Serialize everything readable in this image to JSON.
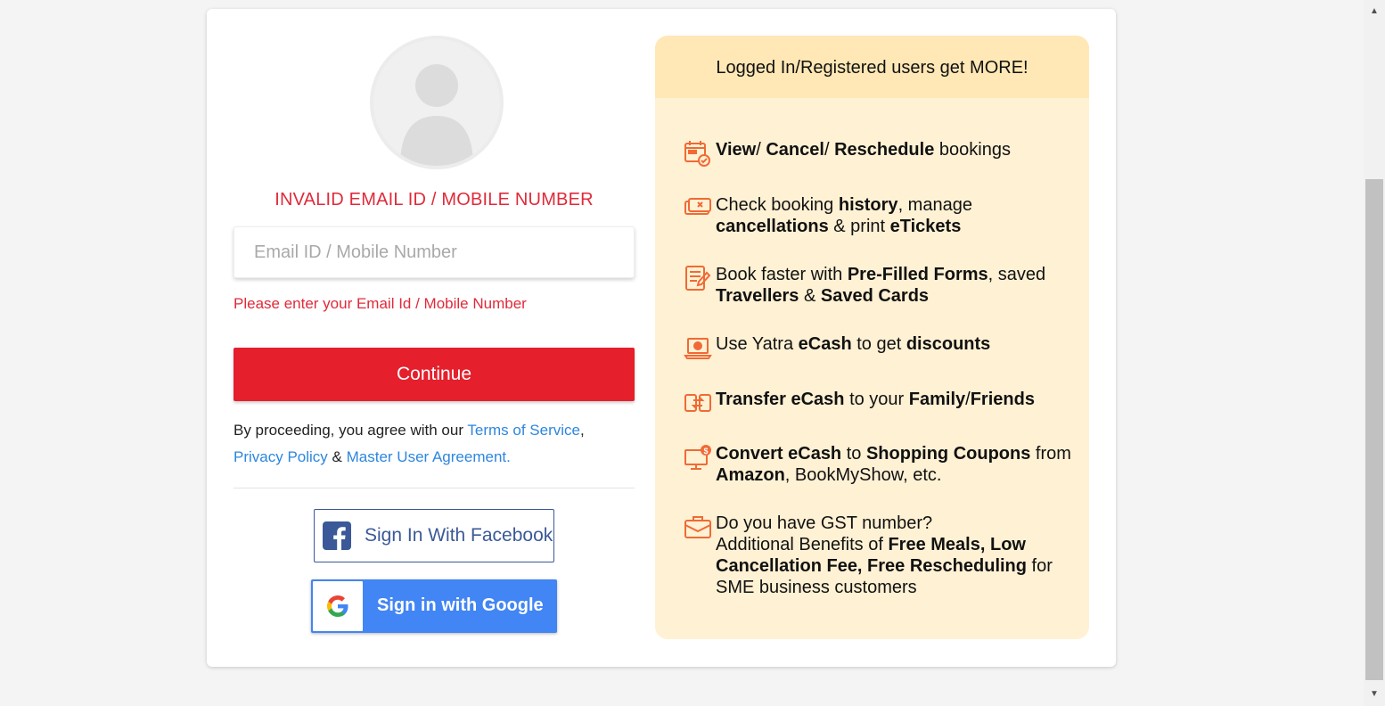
{
  "login": {
    "error_title": "INVALID EMAIL ID / MOBILE NUMBER",
    "email_placeholder": "Email ID / Mobile Number",
    "email_value": "",
    "error_help": "Please enter your Email Id / Mobile Number",
    "continue_label": "Continue",
    "terms": {
      "prefix": "By proceeding, you agree with our ",
      "tos": "Terms of Service",
      "comma": ",",
      "privacy": "Privacy Policy",
      "amp": " & ",
      "agreement": "Master User Agreement."
    },
    "facebook_label": "Sign In With Facebook",
    "google_label": "Sign in with Google"
  },
  "perks": {
    "header": "Logged In/Registered users get MORE!",
    "items": [
      {
        "icon": "calendar-check-icon",
        "parts": [
          [
            "View",
            true
          ],
          [
            "/ ",
            false
          ],
          [
            "Cancel",
            true
          ],
          [
            "/ ",
            false
          ],
          [
            "Reschedule",
            true
          ],
          [
            " bookings",
            false
          ]
        ]
      },
      {
        "icon": "ticket-cancel-icon",
        "parts": [
          [
            "Check booking ",
            false
          ],
          [
            "history",
            true
          ],
          [
            ", manage ",
            false
          ],
          [
            "cancellations",
            true
          ],
          [
            " & print ",
            false
          ],
          [
            "eTickets",
            true
          ]
        ]
      },
      {
        "icon": "form-icon",
        "parts": [
          [
            "Book faster with ",
            false
          ],
          [
            "Pre-Filled Forms",
            true
          ],
          [
            ", saved ",
            false
          ],
          [
            "Travellers",
            true
          ],
          [
            " & ",
            false
          ],
          [
            "Saved Cards",
            true
          ]
        ]
      },
      {
        "icon": "laptop-ecash-icon",
        "parts": [
          [
            "Use Yatra ",
            false
          ],
          [
            "eCash",
            true
          ],
          [
            " to get ",
            false
          ],
          [
            "discounts",
            true
          ]
        ]
      },
      {
        "icon": "transfer-ecash-icon",
        "parts": [
          [
            "Transfer eCash",
            true
          ],
          [
            " to your ",
            false
          ],
          [
            "Family",
            true
          ],
          [
            "/",
            false
          ],
          [
            "Friends",
            true
          ]
        ]
      },
      {
        "icon": "monitor-coupon-icon",
        "parts": [
          [
            "Convert eCash",
            true
          ],
          [
            " to ",
            false
          ],
          [
            "Shopping Coupons",
            true
          ],
          [
            " from ",
            false
          ],
          [
            "Amazon",
            true
          ],
          [
            ", BookMyShow, etc.",
            false
          ]
        ]
      },
      {
        "icon": "briefcase-icon",
        "parts": [
          [
            "Do you have GST number?",
            false
          ],
          [
            "\nAdditional Benefits of ",
            false
          ],
          [
            "Free Meals, Low Cancellation Fee, Free Rescheduling",
            true
          ],
          [
            " for SME business customers",
            false
          ]
        ]
      }
    ]
  },
  "colors": {
    "error": "#e02a3a",
    "primary_button": "#e51f2c",
    "facebook": "#3b5998",
    "google": "#4285f4",
    "link": "#2e86de",
    "perks_bg": "#fff1d4",
    "perks_header_bg": "#ffe8b5",
    "perk_icon": "#f06a35"
  }
}
